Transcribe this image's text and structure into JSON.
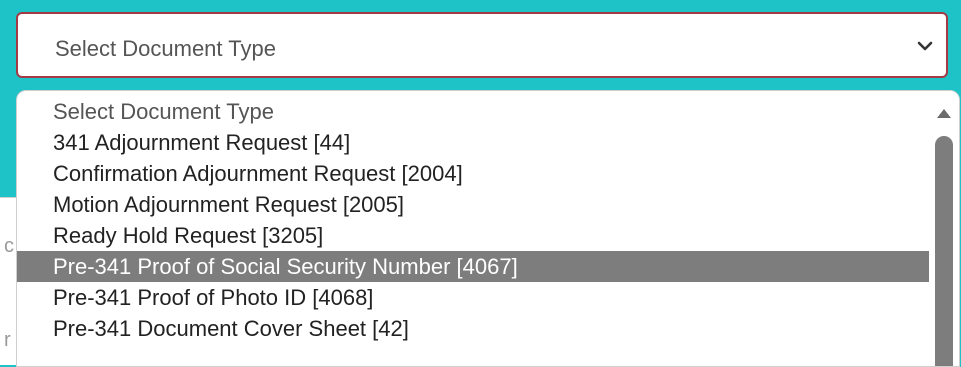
{
  "select": {
    "value": "Select Document Type",
    "chevron_icon": "chevron-down-icon"
  },
  "dropdown": {
    "options": [
      "Select Document Type",
      "341 Adjournment Request [44]",
      "Confirmation Adjournment Request [2004]",
      "Motion Adjournment Request [2005]",
      "Ready Hold Request [3205]",
      "Pre-341 Proof of Social Security Number [4067]",
      "Pre-341 Proof of Photo ID [4068]",
      "Pre-341 Document Cover Sheet [42]"
    ],
    "highlighted_option": "Pre-341 Proof of Social Security Number [4067]",
    "scroll_up_icon": "triangle-up-icon"
  },
  "backdrop": {
    "marks": [
      "c",
      "r"
    ]
  },
  "colors": {
    "page_background": "#1dc3c7",
    "select_border": "#a33a44",
    "highlight": "#7d7d7d",
    "scrollbar_thumb": "#7d7d7d"
  }
}
